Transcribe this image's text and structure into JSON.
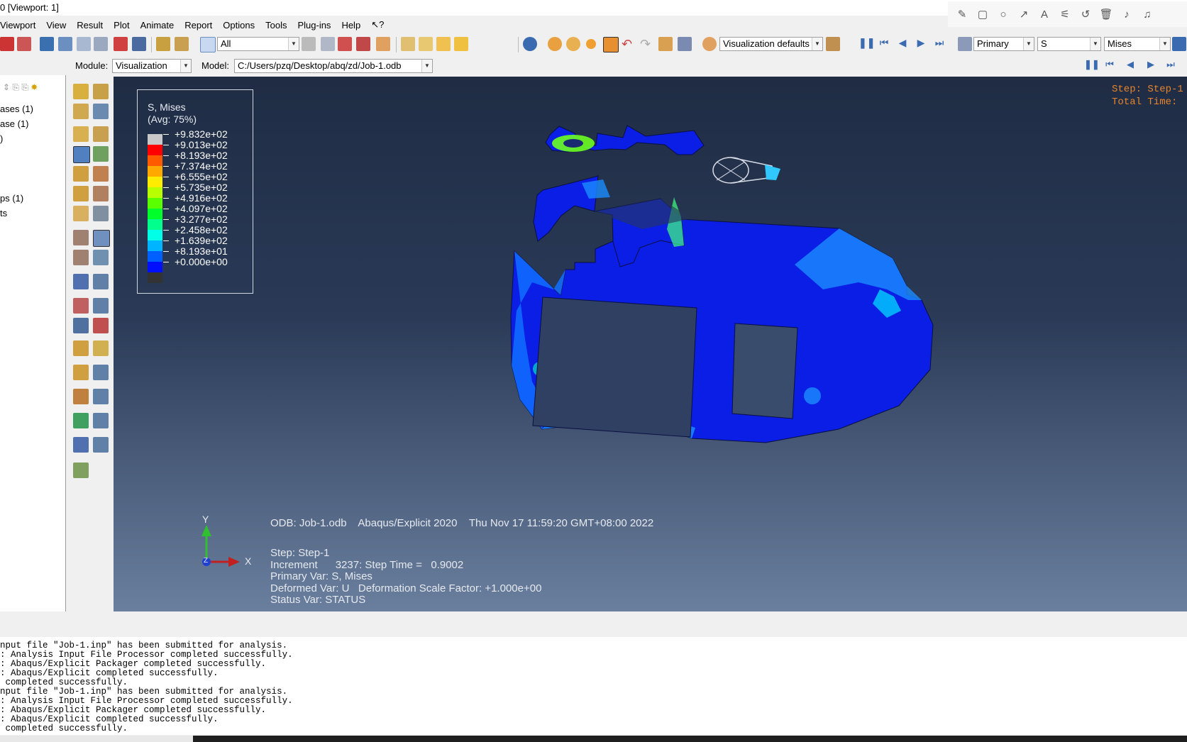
{
  "window": {
    "title": "0 [Viewport: 1]"
  },
  "menu": [
    "Viewport",
    "View",
    "Result",
    "Plot",
    "Animate",
    "Report",
    "Options",
    "Tools",
    "Plug-ins",
    "Help",
    "↖?"
  ],
  "toolbar": {
    "selection_filter": "All",
    "view_defaults": "Visualization defaults",
    "field_primary": "Primary",
    "field_variable": "S",
    "field_invariant": "Mises"
  },
  "context": {
    "module_label": "Module:",
    "module_value": "Visualization",
    "model_label": "Model:",
    "model_value": "C:/Users/pzq/Desktop/abq/zd/Job-1.odb"
  },
  "tree": [
    "ases (1)",
    "ase (1)",
    ")",
    "ps (1)",
    "ts"
  ],
  "legend": {
    "title_line1": "S, Mises",
    "title_line2": "(Avg: 75%)",
    "entries": [
      {
        "label": "+9.832e+02",
        "color": "#c8c8c8"
      },
      {
        "label": "+9.013e+02",
        "color": "#ff0000"
      },
      {
        "label": "+8.193e+02",
        "color": "#ff5a00"
      },
      {
        "label": "+7.374e+02",
        "color": "#ffa800"
      },
      {
        "label": "+6.555e+02",
        "color": "#ffec00"
      },
      {
        "label": "+5.735e+02",
        "color": "#b8ff00"
      },
      {
        "label": "+4.916e+02",
        "color": "#5aff00"
      },
      {
        "label": "+4.097e+02",
        "color": "#00ff2a"
      },
      {
        "label": "+3.277e+02",
        "color": "#00ff8c"
      },
      {
        "label": "+2.458e+02",
        "color": "#00ffe6"
      },
      {
        "label": "+1.639e+02",
        "color": "#00b4ff"
      },
      {
        "label": "+8.193e+01",
        "color": "#0060ff"
      },
      {
        "label": "+0.000e+00",
        "color": "#0010ff"
      },
      {
        "label": "",
        "color": "#333333"
      }
    ]
  },
  "viewport_info": {
    "step_top": "Step: Step-1",
    "time_top": "Total Time:",
    "odb_line": "ODB: Job-1.odb    Abaqus/Explicit 2020    Thu Nov 17 11:59:20 GMT+08:00 2022",
    "step": "Step: Step-1",
    "increment": "Increment      3237: Step Time =   0.9002",
    "primary_var": "Primary Var: S, Mises",
    "deformed_var": "Deformed Var: U   Deformation Scale Factor: +1.000e+00",
    "status_var": "Status Var: STATUS",
    "axis_y": "Y",
    "axis_x": "X",
    "axis_z": "Z"
  },
  "messages": [
    "nput file \"Job-1.inp\" has been submitted for analysis.",
    ": Analysis Input File Processor completed successfully.",
    ": Abaqus/Explicit Packager completed successfully.",
    ": Abaqus/Explicit completed successfully.",
    " completed successfully.",
    "nput file \"Job-1.inp\" has been submitted for analysis.",
    ": Analysis Input File Processor completed successfully.",
    ": Abaqus/Explicit Packager completed successfully.",
    ": Abaqus/Explicit completed successfully.",
    " completed successfully."
  ],
  "colors": {
    "viewport_top": "#1f2c44",
    "viewport_bottom": "#6a7f9e",
    "info_orange": "#e8852a",
    "mesh_blue": "#0a1ee6"
  }
}
